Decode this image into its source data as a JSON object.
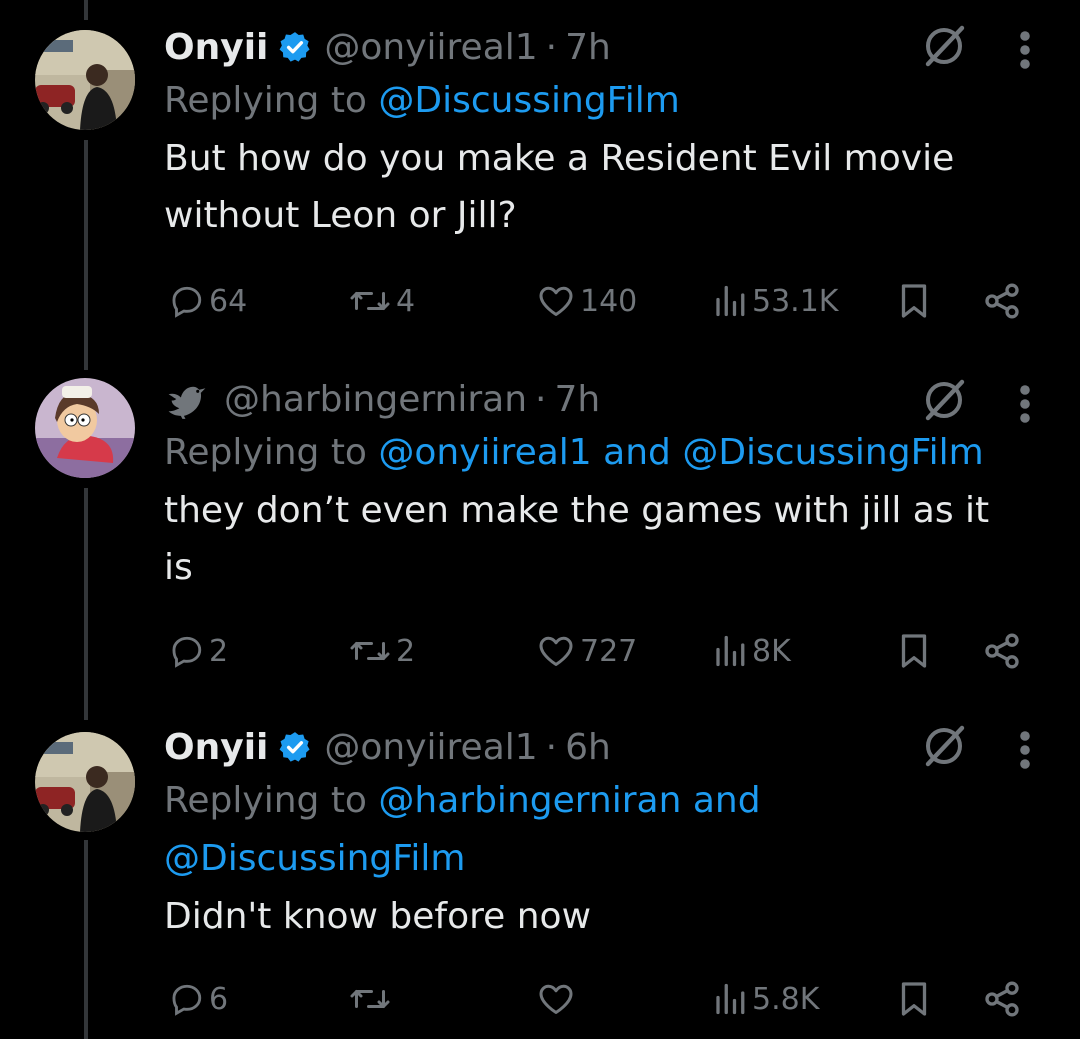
{
  "tweets": [
    {
      "name": "Onyii",
      "handle": "@onyiireal1",
      "time": "7h",
      "replying_prefix": "Replying to ",
      "mentions_line1": "@DiscussingFilm",
      "body_line1": "But how do you make a Resident Evil movie",
      "body_line2": "without Leon or Jill?",
      "replies": "64",
      "reposts": "4",
      "likes": "140",
      "views": "53.1K"
    },
    {
      "handle": "@harbingerniran",
      "time": "7h",
      "replying_prefix": "Replying to ",
      "mention_a": "@onyiireal1",
      "mention_and": " and ",
      "mention_b": "@DiscussingFilm",
      "body_line1": "they don’t even make the games with jill as it",
      "body_line2": "is",
      "replies": "2",
      "reposts": "2",
      "likes": "727",
      "views": "8K"
    },
    {
      "name": "Onyii",
      "handle": "@onyiireal1",
      "time": "6h",
      "replying_prefix": "Replying to ",
      "mentions_line1": "@harbingerniran and",
      "mentions_line2": "@DiscussingFilm",
      "body_line1": "Didn't know before now",
      "replies": "6",
      "views": "5.8K"
    }
  ],
  "separator": "·",
  "colors": {
    "background": "#000000",
    "text": "#e7e9ea",
    "secondary": "#71767b",
    "accent": "#1d9bf0"
  },
  "icons": [
    "verified-badge-icon",
    "bird-icon",
    "grok-icon",
    "more-icon",
    "reply-icon",
    "repost-icon",
    "like-icon",
    "views-icon",
    "bookmark-icon",
    "share-icon"
  ]
}
